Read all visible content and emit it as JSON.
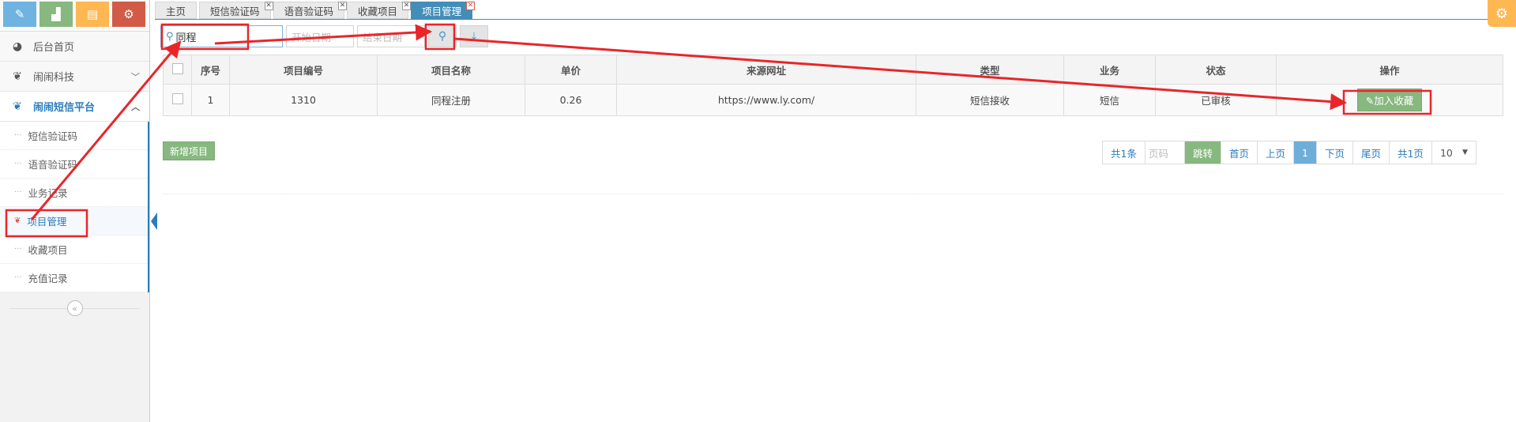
{
  "shortcuts": [
    {
      "icon": "pencil-icon",
      "glyph": "✎",
      "color": "#6fb3e0"
    },
    {
      "icon": "signal-icon",
      "glyph": "▟",
      "color": "#87b87f"
    },
    {
      "icon": "book-icon",
      "glyph": "▤",
      "color": "#ffb752"
    },
    {
      "icon": "cogs-icon",
      "glyph": "⚙",
      "color": "#d15b47"
    }
  ],
  "nav": {
    "home": "后台首页",
    "tech": "闹闹科技",
    "sms_platform": "闹闹短信平台",
    "sub_items": [
      "短信验证码",
      "语音验证码",
      "业务记录",
      "项目管理",
      "收藏项目",
      "充值记录"
    ]
  },
  "tabs": [
    {
      "label": "主页",
      "closable": false,
      "active": false
    },
    {
      "label": "短信验证码",
      "closable": true,
      "active": false
    },
    {
      "label": "语音验证码",
      "closable": true,
      "active": false
    },
    {
      "label": "收藏项目",
      "closable": true,
      "active": false
    },
    {
      "label": "项目管理",
      "closable": true,
      "active": true
    }
  ],
  "toolbar": {
    "search_value": "同程",
    "start_date_placeholder": "开始日期",
    "end_date_placeholder": "结束日期"
  },
  "table": {
    "headers": [
      "序号",
      "项目编号",
      "项目名称",
      "单价",
      "来源网址",
      "类型",
      "业务",
      "状态",
      "操作"
    ],
    "rows": [
      {
        "index": "1",
        "code": "1310",
        "name": "同程注册",
        "price": "0.26",
        "url": "https://www.ly.com/",
        "type": "短信接收",
        "business": "短信",
        "status": "已审核",
        "action": "加入收藏"
      }
    ]
  },
  "add_button": "新增项目",
  "pager": {
    "total": "共1条",
    "page_input_placeholder": "页码",
    "jump": "跳转",
    "first": "首页",
    "prev": "上页",
    "current": "1",
    "next": "下页",
    "last": "尾页",
    "pages": "共1页",
    "page_size": "10"
  },
  "colors": {
    "accent": "#438eb9",
    "success": "#87b87f",
    "annotation": "#e8262a"
  }
}
